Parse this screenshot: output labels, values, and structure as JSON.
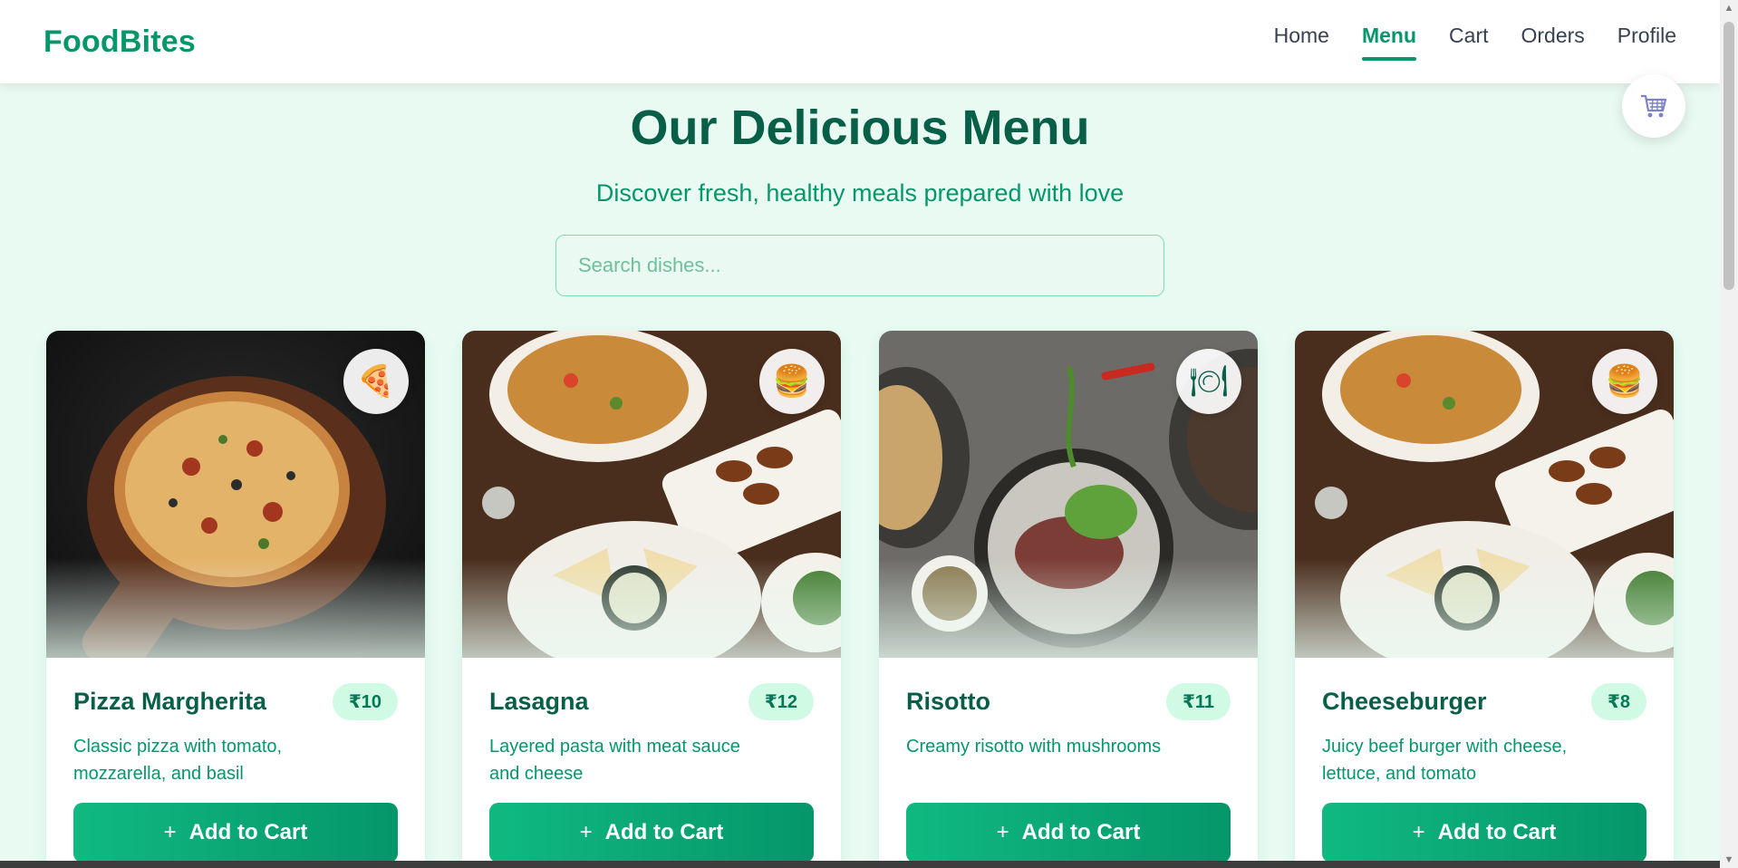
{
  "nav": {
    "brand": "FoodBites",
    "links": [
      "Home",
      "Menu",
      "Cart",
      "Orders",
      "Profile"
    ],
    "active": "Menu"
  },
  "hero": {
    "title": "Our Delicious Menu",
    "subtitle": "Discover fresh, healthy meals prepared with love",
    "search_placeholder": "Search dishes..."
  },
  "cards": [
    {
      "name": "Pizza Margherita",
      "price": "₹10",
      "description": "Classic pizza with tomato, mozzarella, and basil",
      "icon": "🍕",
      "icon_name": "pizza-icon",
      "button": "Add to Cart"
    },
    {
      "name": "Lasagna",
      "price": "₹12",
      "description": "Layered pasta with meat sauce and cheese",
      "icon": "🍔",
      "icon_name": "burger-icon",
      "button": "Add to Cart"
    },
    {
      "name": "Risotto",
      "price": "₹11",
      "description": "Creamy risotto with mushrooms",
      "icon": "🍽",
      "icon_name": "plate-icon",
      "button": "Add to Cart"
    },
    {
      "name": "Cheeseburger",
      "price": "₹8",
      "description": "Juicy beef burger with cheese, lettuce, and tomato",
      "icon": "🍔",
      "icon_name": "burger-icon",
      "button": "Add to Cart"
    }
  ],
  "colors": {
    "brand": "#059669",
    "background": "#e9faf2",
    "button_start": "#10b981",
    "button_end": "#059669"
  }
}
